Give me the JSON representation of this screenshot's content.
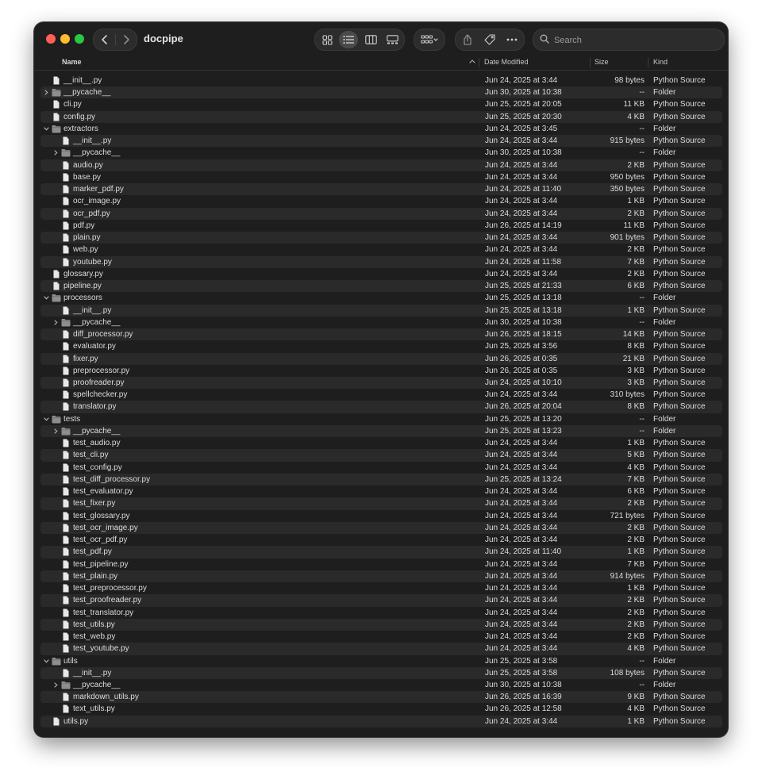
{
  "window": {
    "title": "docpipe"
  },
  "search": {
    "placeholder": "Search"
  },
  "columns": {
    "name": "Name",
    "date": "Date Modified",
    "size": "Size",
    "kind": "Kind"
  },
  "icons": {
    "back": "chevron-left-icon",
    "forward": "chevron-right-icon",
    "views": [
      "icon-view-icon",
      "list-view-icon",
      "column-view-icon",
      "gallery-view-icon"
    ],
    "group": "group-by-icon",
    "share": "share-icon",
    "tag": "tag-icon",
    "more": "more-icon",
    "search": "search-icon",
    "folder": "folder-icon",
    "file": "document-icon"
  },
  "colors": {
    "window_bg": "#1e1e1e",
    "row_alt": "#2a2a2a",
    "text": "#dcdcdc",
    "folder": "#8e8e8e"
  },
  "rows": [
    {
      "name": "__init__.py",
      "depth": 0,
      "type": "file",
      "date": "Jun 24, 2025 at 3:44",
      "size": "98 bytes",
      "kind": "Python Source"
    },
    {
      "name": "__pycache__",
      "depth": 0,
      "type": "folder",
      "expanded": false,
      "date": "Jun 30, 2025 at 10:38",
      "size": "--",
      "kind": "Folder"
    },
    {
      "name": "cli.py",
      "depth": 0,
      "type": "file",
      "date": "Jun 25, 2025 at 20:05",
      "size": "11 KB",
      "kind": "Python Source"
    },
    {
      "name": "config.py",
      "depth": 0,
      "type": "file",
      "date": "Jun 25, 2025 at 20:30",
      "size": "4 KB",
      "kind": "Python Source"
    },
    {
      "name": "extractors",
      "depth": 0,
      "type": "folder",
      "expanded": true,
      "date": "Jun 24, 2025 at 3:45",
      "size": "--",
      "kind": "Folder"
    },
    {
      "name": "__init__.py",
      "depth": 1,
      "type": "file",
      "date": "Jun 24, 2025 at 3:44",
      "size": "915 bytes",
      "kind": "Python Source"
    },
    {
      "name": "__pycache__",
      "depth": 1,
      "type": "folder",
      "expanded": false,
      "date": "Jun 30, 2025 at 10:38",
      "size": "--",
      "kind": "Folder"
    },
    {
      "name": "audio.py",
      "depth": 1,
      "type": "file",
      "date": "Jun 24, 2025 at 3:44",
      "size": "2 KB",
      "kind": "Python Source"
    },
    {
      "name": "base.py",
      "depth": 1,
      "type": "file",
      "date": "Jun 24, 2025 at 3:44",
      "size": "950 bytes",
      "kind": "Python Source"
    },
    {
      "name": "marker_pdf.py",
      "depth": 1,
      "type": "file",
      "date": "Jun 24, 2025 at 11:40",
      "size": "350 bytes",
      "kind": "Python Source"
    },
    {
      "name": "ocr_image.py",
      "depth": 1,
      "type": "file",
      "date": "Jun 24, 2025 at 3:44",
      "size": "1 KB",
      "kind": "Python Source"
    },
    {
      "name": "ocr_pdf.py",
      "depth": 1,
      "type": "file",
      "date": "Jun 24, 2025 at 3:44",
      "size": "2 KB",
      "kind": "Python Source"
    },
    {
      "name": "pdf.py",
      "depth": 1,
      "type": "file",
      "date": "Jun 26, 2025 at 14:19",
      "size": "11 KB",
      "kind": "Python Source"
    },
    {
      "name": "plain.py",
      "depth": 1,
      "type": "file",
      "date": "Jun 24, 2025 at 3:44",
      "size": "901 bytes",
      "kind": "Python Source"
    },
    {
      "name": "web.py",
      "depth": 1,
      "type": "file",
      "date": "Jun 24, 2025 at 3:44",
      "size": "2 KB",
      "kind": "Python Source"
    },
    {
      "name": "youtube.py",
      "depth": 1,
      "type": "file",
      "date": "Jun 24, 2025 at 11:58",
      "size": "7 KB",
      "kind": "Python Source"
    },
    {
      "name": "glossary.py",
      "depth": 0,
      "type": "file",
      "date": "Jun 24, 2025 at 3:44",
      "size": "2 KB",
      "kind": "Python Source"
    },
    {
      "name": "pipeline.py",
      "depth": 0,
      "type": "file",
      "date": "Jun 25, 2025 at 21:33",
      "size": "6 KB",
      "kind": "Python Source"
    },
    {
      "name": "processors",
      "depth": 0,
      "type": "folder",
      "expanded": true,
      "date": "Jun 25, 2025 at 13:18",
      "size": "--",
      "kind": "Folder"
    },
    {
      "name": "__init__.py",
      "depth": 1,
      "type": "file",
      "date": "Jun 25, 2025 at 13:18",
      "size": "1 KB",
      "kind": "Python Source"
    },
    {
      "name": "__pycache__",
      "depth": 1,
      "type": "folder",
      "expanded": false,
      "date": "Jun 30, 2025 at 10:38",
      "size": "--",
      "kind": "Folder"
    },
    {
      "name": "diff_processor.py",
      "depth": 1,
      "type": "file",
      "date": "Jun 26, 2025 at 18:15",
      "size": "14 KB",
      "kind": "Python Source"
    },
    {
      "name": "evaluator.py",
      "depth": 1,
      "type": "file",
      "date": "Jun 25, 2025 at 3:56",
      "size": "8 KB",
      "kind": "Python Source"
    },
    {
      "name": "fixer.py",
      "depth": 1,
      "type": "file",
      "date": "Jun 26, 2025 at 0:35",
      "size": "21 KB",
      "kind": "Python Source"
    },
    {
      "name": "preprocessor.py",
      "depth": 1,
      "type": "file",
      "date": "Jun 26, 2025 at 0:35",
      "size": "3 KB",
      "kind": "Python Source"
    },
    {
      "name": "proofreader.py",
      "depth": 1,
      "type": "file",
      "date": "Jun 24, 2025 at 10:10",
      "size": "3 KB",
      "kind": "Python Source"
    },
    {
      "name": "spellchecker.py",
      "depth": 1,
      "type": "file",
      "date": "Jun 24, 2025 at 3:44",
      "size": "310 bytes",
      "kind": "Python Source"
    },
    {
      "name": "translator.py",
      "depth": 1,
      "type": "file",
      "date": "Jun 26, 2025 at 20:04",
      "size": "8 KB",
      "kind": "Python Source"
    },
    {
      "name": "tests",
      "depth": 0,
      "type": "folder",
      "expanded": true,
      "date": "Jun 25, 2025 at 13:20",
      "size": "--",
      "kind": "Folder"
    },
    {
      "name": "__pycache__",
      "depth": 1,
      "type": "folder",
      "expanded": false,
      "date": "Jun 25, 2025 at 13:23",
      "size": "--",
      "kind": "Folder"
    },
    {
      "name": "test_audio.py",
      "depth": 1,
      "type": "file",
      "date": "Jun 24, 2025 at 3:44",
      "size": "1 KB",
      "kind": "Python Source"
    },
    {
      "name": "test_cli.py",
      "depth": 1,
      "type": "file",
      "date": "Jun 24, 2025 at 3:44",
      "size": "5 KB",
      "kind": "Python Source"
    },
    {
      "name": "test_config.py",
      "depth": 1,
      "type": "file",
      "date": "Jun 24, 2025 at 3:44",
      "size": "4 KB",
      "kind": "Python Source"
    },
    {
      "name": "test_diff_processor.py",
      "depth": 1,
      "type": "file",
      "date": "Jun 25, 2025 at 13:24",
      "size": "7 KB",
      "kind": "Python Source"
    },
    {
      "name": "test_evaluator.py",
      "depth": 1,
      "type": "file",
      "date": "Jun 24, 2025 at 3:44",
      "size": "6 KB",
      "kind": "Python Source"
    },
    {
      "name": "test_fixer.py",
      "depth": 1,
      "type": "file",
      "date": "Jun 24, 2025 at 3:44",
      "size": "2 KB",
      "kind": "Python Source"
    },
    {
      "name": "test_glossary.py",
      "depth": 1,
      "type": "file",
      "date": "Jun 24, 2025 at 3:44",
      "size": "721 bytes",
      "kind": "Python Source"
    },
    {
      "name": "test_ocr_image.py",
      "depth": 1,
      "type": "file",
      "date": "Jun 24, 2025 at 3:44",
      "size": "2 KB",
      "kind": "Python Source"
    },
    {
      "name": "test_ocr_pdf.py",
      "depth": 1,
      "type": "file",
      "date": "Jun 24, 2025 at 3:44",
      "size": "2 KB",
      "kind": "Python Source"
    },
    {
      "name": "test_pdf.py",
      "depth": 1,
      "type": "file",
      "date": "Jun 24, 2025 at 11:40",
      "size": "1 KB",
      "kind": "Python Source"
    },
    {
      "name": "test_pipeline.py",
      "depth": 1,
      "type": "file",
      "date": "Jun 24, 2025 at 3:44",
      "size": "7 KB",
      "kind": "Python Source"
    },
    {
      "name": "test_plain.py",
      "depth": 1,
      "type": "file",
      "date": "Jun 24, 2025 at 3:44",
      "size": "914 bytes",
      "kind": "Python Source"
    },
    {
      "name": "test_preprocessor.py",
      "depth": 1,
      "type": "file",
      "date": "Jun 24, 2025 at 3:44",
      "size": "1 KB",
      "kind": "Python Source"
    },
    {
      "name": "test_proofreader.py",
      "depth": 1,
      "type": "file",
      "date": "Jun 24, 2025 at 3:44",
      "size": "2 KB",
      "kind": "Python Source"
    },
    {
      "name": "test_translator.py",
      "depth": 1,
      "type": "file",
      "date": "Jun 24, 2025 at 3:44",
      "size": "2 KB",
      "kind": "Python Source"
    },
    {
      "name": "test_utils.py",
      "depth": 1,
      "type": "file",
      "date": "Jun 24, 2025 at 3:44",
      "size": "2 KB",
      "kind": "Python Source"
    },
    {
      "name": "test_web.py",
      "depth": 1,
      "type": "file",
      "date": "Jun 24, 2025 at 3:44",
      "size": "2 KB",
      "kind": "Python Source"
    },
    {
      "name": "test_youtube.py",
      "depth": 1,
      "type": "file",
      "date": "Jun 24, 2025 at 3:44",
      "size": "4 KB",
      "kind": "Python Source"
    },
    {
      "name": "utils",
      "depth": 0,
      "type": "folder",
      "expanded": true,
      "date": "Jun 25, 2025 at 3:58",
      "size": "--",
      "kind": "Folder"
    },
    {
      "name": "__init__.py",
      "depth": 1,
      "type": "file",
      "date": "Jun 25, 2025 at 3:58",
      "size": "108 bytes",
      "kind": "Python Source"
    },
    {
      "name": "__pycache__",
      "depth": 1,
      "type": "folder",
      "expanded": false,
      "date": "Jun 30, 2025 at 10:38",
      "size": "--",
      "kind": "Folder"
    },
    {
      "name": "markdown_utils.py",
      "depth": 1,
      "type": "file",
      "date": "Jun 26, 2025 at 16:39",
      "size": "9 KB",
      "kind": "Python Source"
    },
    {
      "name": "text_utils.py",
      "depth": 1,
      "type": "file",
      "date": "Jun 26, 2025 at 12:58",
      "size": "4 KB",
      "kind": "Python Source"
    },
    {
      "name": "utils.py",
      "depth": 0,
      "type": "file",
      "date": "Jun 24, 2025 at 3:44",
      "size": "1 KB",
      "kind": "Python Source"
    }
  ]
}
